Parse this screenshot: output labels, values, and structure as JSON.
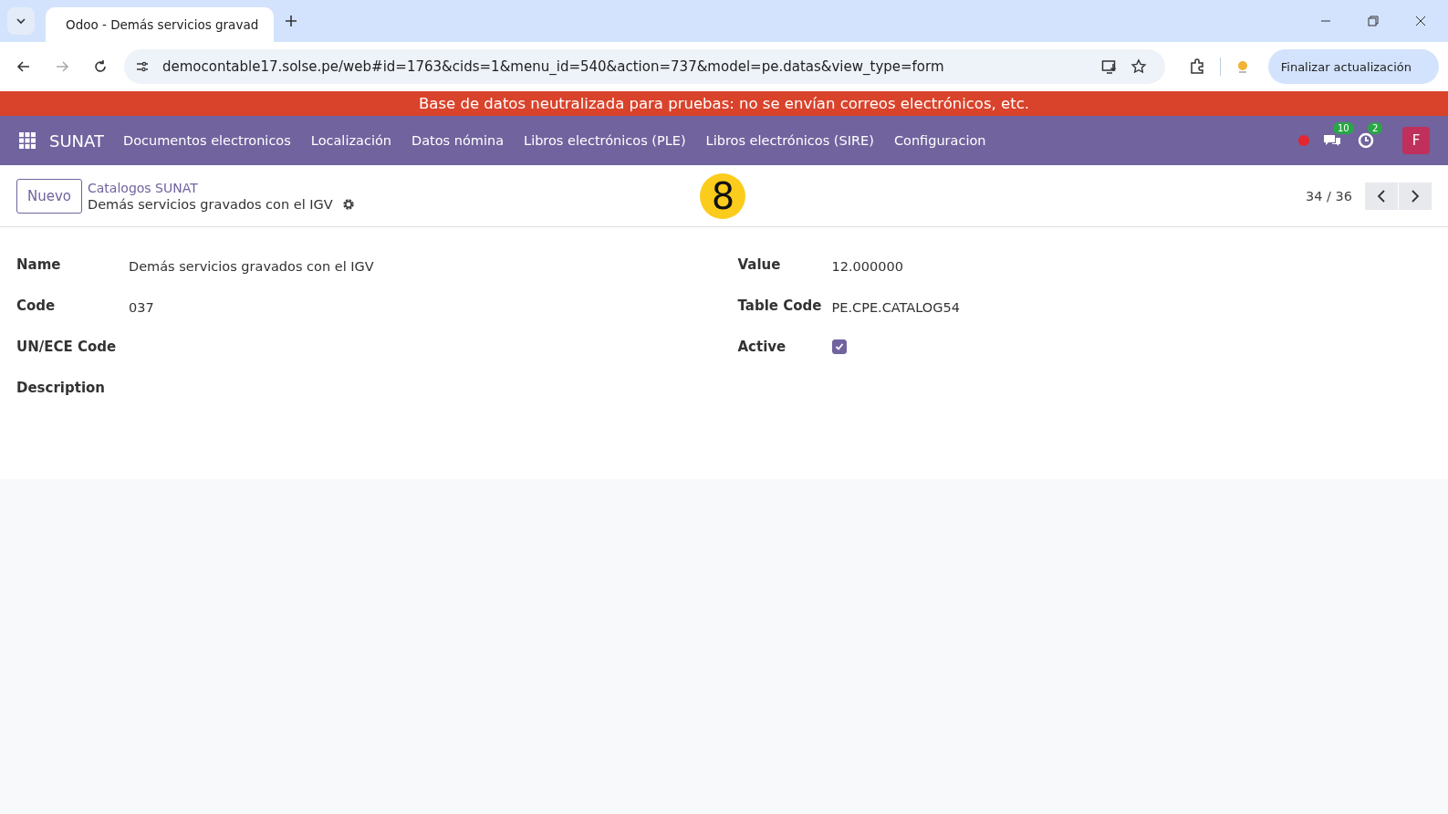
{
  "browser": {
    "tab_title": "Odoo - Demás servicios gravad",
    "url": "democontable17.solse.pe/web#id=1763&cids=1&menu_id=540&action=737&model=pe.datas&view_type=form",
    "update_button": "Finalizar actualización"
  },
  "banner": "Base de datos neutralizada para pruebas: no se envían correos electrónicos, etc.",
  "navbar": {
    "app": "SUNAT",
    "menus": [
      "Documentos electronicos",
      "Localización",
      "Datos nómina",
      "Libros electrónicos (PLE)",
      "Libros electrónicos (SIRE)",
      "Configuracion"
    ],
    "messages_badge": "10",
    "activities_badge": "2",
    "avatar": "F"
  },
  "control_panel": {
    "new_button": "Nuevo",
    "breadcrumb": "Catalogos SUNAT",
    "record_title": "Demás servicios gravados con el IGV",
    "pager": "34 / 36",
    "step_marker": "8"
  },
  "form": {
    "left": [
      {
        "label": "Name",
        "kind": "text",
        "value": "Demás servicios gravados con el IGV"
      },
      {
        "label": "Code",
        "kind": "text",
        "value": "037"
      },
      {
        "label": "UN/ECE Code",
        "kind": "text"
      },
      {
        "label": "Description",
        "kind": "text"
      }
    ],
    "right": [
      {
        "label": "Value",
        "kind": "text",
        "value": "12.000000"
      },
      {
        "label": "Table Code",
        "kind": "text",
        "value": "PE.CPE.CATALOG54"
      },
      {
        "label": "Active",
        "kind": "checkbox",
        "checked": true
      }
    ]
  }
}
